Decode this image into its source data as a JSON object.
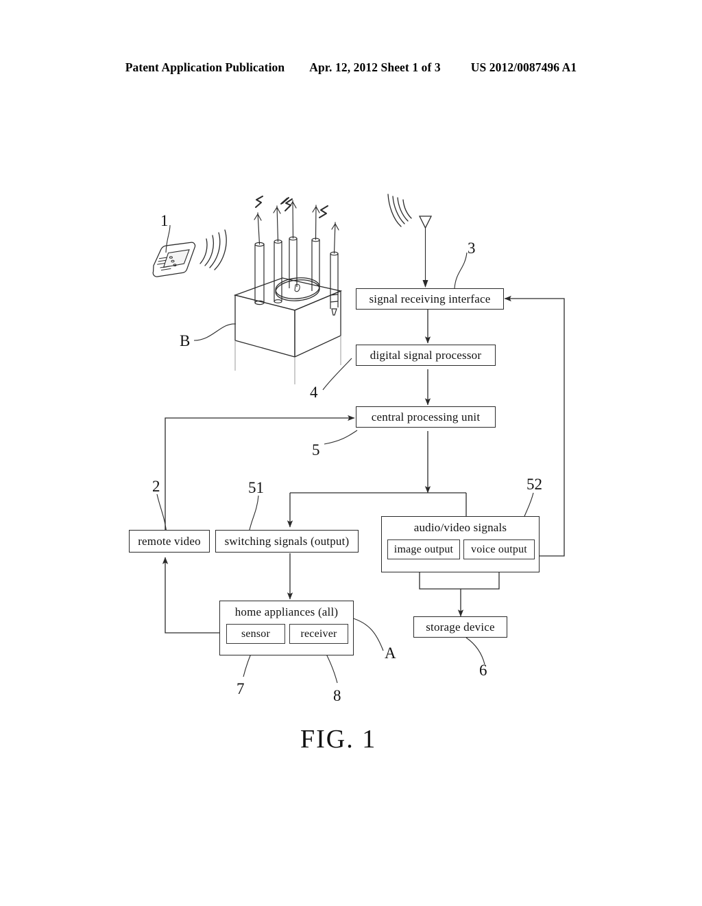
{
  "header": {
    "publication": "Patent Application Publication",
    "date_sheet": "Apr. 12, 2012  Sheet 1 of 3",
    "pub_number": "US 2012/0087496 A1"
  },
  "figure": {
    "caption": "FIG. 1"
  },
  "nodes": {
    "signal_receiving_interface": "signal receiving interface",
    "digital_signal_processor": "digital signal processor",
    "central_processing_unit": "central processing unit",
    "remote_video": "remote video",
    "switching_signals": "switching signals (output)",
    "audio_video_signals": "audio/video signals",
    "image_output": "image output",
    "voice_output": "voice output",
    "home_appliances": "home appliances (all)",
    "sensor": "sensor",
    "receiver": "receiver",
    "storage_device": "storage device"
  },
  "numerals": {
    "n1": "1",
    "n2": "2",
    "n3": "3",
    "n4": "4",
    "n5": "5",
    "n6": "6",
    "n7": "7",
    "n8": "8",
    "n51": "51",
    "n52": "52",
    "nA": "A",
    "nB": "B"
  },
  "icons": {
    "remote_control": "remote-control-icon",
    "antenna_array_box": "antenna-array-box-icon",
    "receiving_antenna": "receiving-antenna-icon",
    "signal_waves": "signal-waves-icon"
  },
  "colors": {
    "ink": "#111111",
    "line": "#2a2a2a",
    "paper": "#ffffff"
  }
}
